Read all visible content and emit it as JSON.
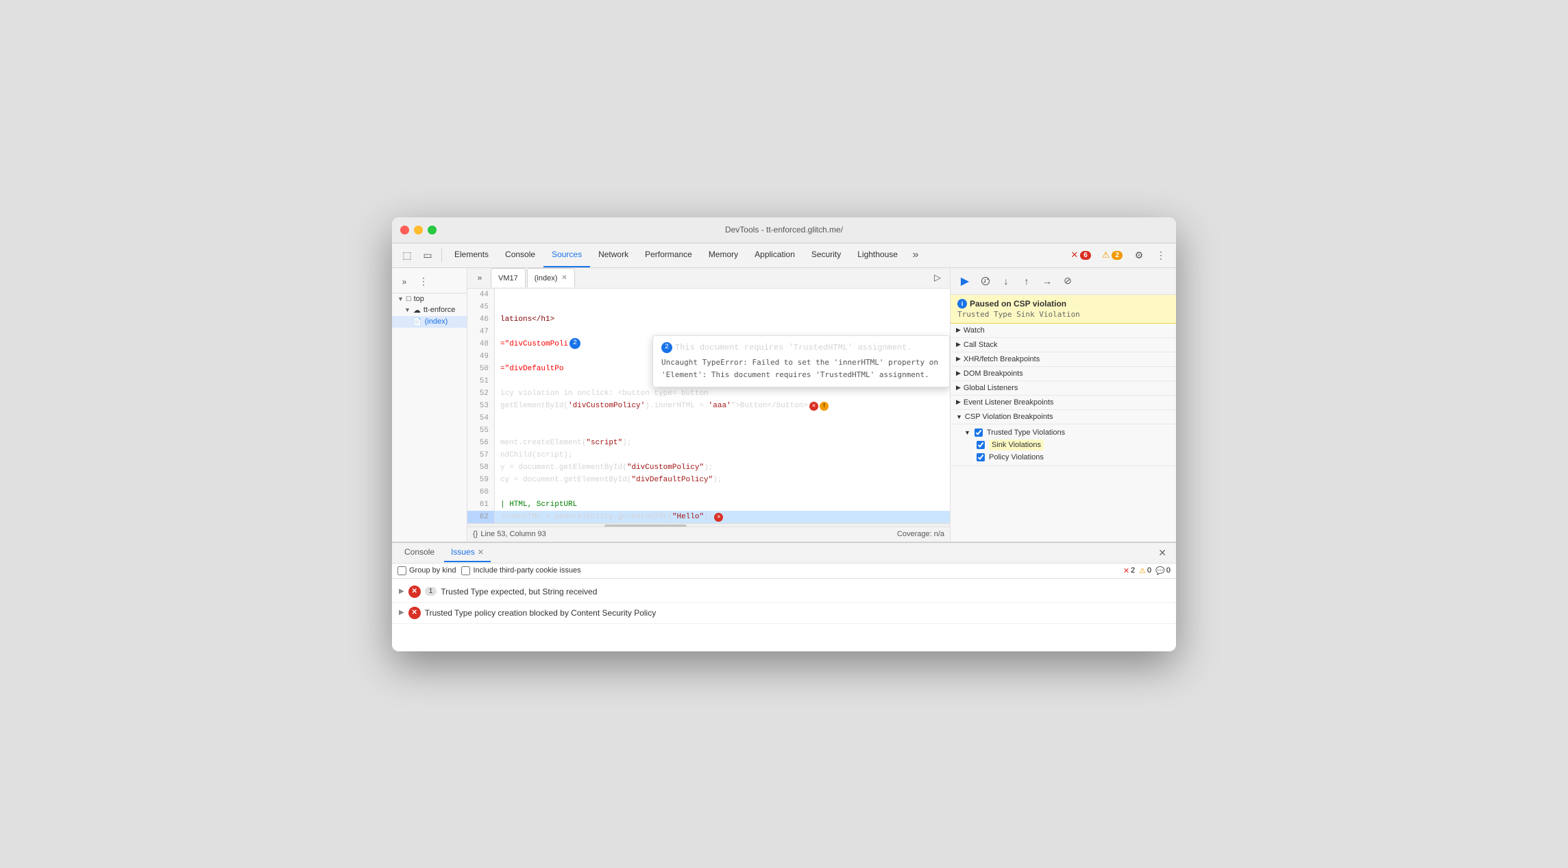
{
  "window": {
    "title": "DevTools - tt-enforced.glitch.me/"
  },
  "toolbar": {
    "tabs": [
      {
        "id": "elements",
        "label": "Elements",
        "active": false
      },
      {
        "id": "console",
        "label": "Console",
        "active": false
      },
      {
        "id": "sources",
        "label": "Sources",
        "active": true
      },
      {
        "id": "network",
        "label": "Network",
        "active": false
      },
      {
        "id": "performance",
        "label": "Performance",
        "active": false
      },
      {
        "id": "memory",
        "label": "Memory",
        "active": false
      },
      {
        "id": "application",
        "label": "Application",
        "active": false
      },
      {
        "id": "security",
        "label": "Security",
        "active": false
      },
      {
        "id": "lighthouse",
        "label": "Lighthouse",
        "active": false
      }
    ],
    "error_count": "6",
    "warning_count": "2"
  },
  "file_tree": {
    "items": [
      {
        "label": "top",
        "type": "folder",
        "expanded": true,
        "indent": 0
      },
      {
        "label": "tt-enforce",
        "type": "cloud",
        "expanded": true,
        "indent": 1
      },
      {
        "label": "(index)",
        "type": "file",
        "selected": true,
        "indent": 2
      }
    ]
  },
  "file_tabs": {
    "tabs": [
      {
        "label": "VM17",
        "closeable": false
      },
      {
        "label": "(index)",
        "closeable": true
      }
    ],
    "active": 1
  },
  "source_code": {
    "lines": [
      {
        "num": 44,
        "content": ""
      },
      {
        "num": 45,
        "content": ""
      },
      {
        "num": 46,
        "content": "lations</h1>",
        "highlight": false
      },
      {
        "num": 47,
        "content": ""
      },
      {
        "num": 48,
        "content": "=\"divCustomPoli",
        "has_error": true,
        "highlight": false
      },
      {
        "num": 49,
        "content": ""
      },
      {
        "num": 50,
        "content": "=\"divDefaultPo",
        "highlight": false
      },
      {
        "num": 51,
        "content": ""
      },
      {
        "num": 52,
        "content": "icy violation in onclick: <button type= button",
        "highlight": false
      },
      {
        "num": 53,
        "content": "getElementById('divCustomPolicy').innerHTML = 'aaa'\">Button</button>",
        "has_error": true,
        "has_warn": true,
        "highlight": false
      },
      {
        "num": 54,
        "content": ""
      },
      {
        "num": 55,
        "content": ""
      },
      {
        "num": 56,
        "content": "ment.createElement(\"script\");",
        "highlight": false
      },
      {
        "num": 57,
        "content": "ndChild(script);",
        "highlight": false
      },
      {
        "num": 58,
        "content": "y = document.getElementById(\"divCustomPolicy\");",
        "highlight": false
      },
      {
        "num": 59,
        "content": "cy = document.getElementById(\"divDefaultPolicy\");",
        "highlight": false
      },
      {
        "num": 60,
        "content": ""
      },
      {
        "num": 61,
        "content": "| HTML, ScriptURL",
        "highlight": false
      },
      {
        "num": 62,
        "content": "innerHTML = generalPolicy.DcreateHTML(\"Hello\");",
        "highlight": true,
        "has_error": true
      }
    ]
  },
  "tooltip": {
    "badge": "2",
    "line1": "This document requires 'TrustedHTML' assignment.",
    "line2": "Uncaught TypeError: Failed to set the 'innerHTML' property on 'Element': This document requires 'TrustedHTML' assignment."
  },
  "status_bar": {
    "format_icon": "{}",
    "position": "Line 53, Column 93",
    "coverage": "Coverage: n/a"
  },
  "debugger": {
    "toolbar_buttons": [
      {
        "id": "resume",
        "icon": "▶",
        "active": true
      },
      {
        "id": "step-over",
        "icon": "↷"
      },
      {
        "id": "step-into",
        "icon": "↓"
      },
      {
        "id": "step-out",
        "icon": "↑"
      },
      {
        "id": "step",
        "icon": "→"
      },
      {
        "id": "deactivate",
        "icon": "⊘"
      }
    ],
    "paused": {
      "title": "Paused on CSP violation",
      "subtitle": "Trusted Type Sink Violation"
    },
    "sections": [
      {
        "label": "Watch",
        "expanded": false
      },
      {
        "label": "Call Stack",
        "expanded": false
      },
      {
        "label": "XHR/fetch Breakpoints",
        "expanded": false
      },
      {
        "label": "DOM Breakpoints",
        "expanded": false
      },
      {
        "label": "Global Listeners",
        "expanded": false
      },
      {
        "label": "Event Listener Breakpoints",
        "expanded": false
      },
      {
        "label": "CSP Violation Breakpoints",
        "expanded": true,
        "children": [
          {
            "label": "Trusted Type Violations",
            "expanded": true,
            "checked": true,
            "children": [
              {
                "label": "Sink Violations",
                "checked": true,
                "highlighted": true
              },
              {
                "label": "Policy Violations",
                "checked": true,
                "highlighted": false
              }
            ]
          }
        ]
      }
    ]
  },
  "bottom_panel": {
    "tabs": [
      {
        "label": "Console",
        "active": false,
        "closeable": false
      },
      {
        "label": "Issues",
        "active": true,
        "closeable": true
      }
    ],
    "controls": {
      "group_by_kind_label": "Group by kind",
      "include_third_party_label": "Include third-party cookie issues",
      "error_count": "2",
      "warning_count": "0",
      "info_count": "0"
    },
    "issues": [
      {
        "arrow": "▶",
        "icon": "✕",
        "count": "1",
        "text": "Trusted Type expected, but String received"
      },
      {
        "arrow": "▶",
        "icon": "✕",
        "count": "",
        "text": "Trusted Type policy creation blocked by Content Security Policy"
      }
    ]
  }
}
